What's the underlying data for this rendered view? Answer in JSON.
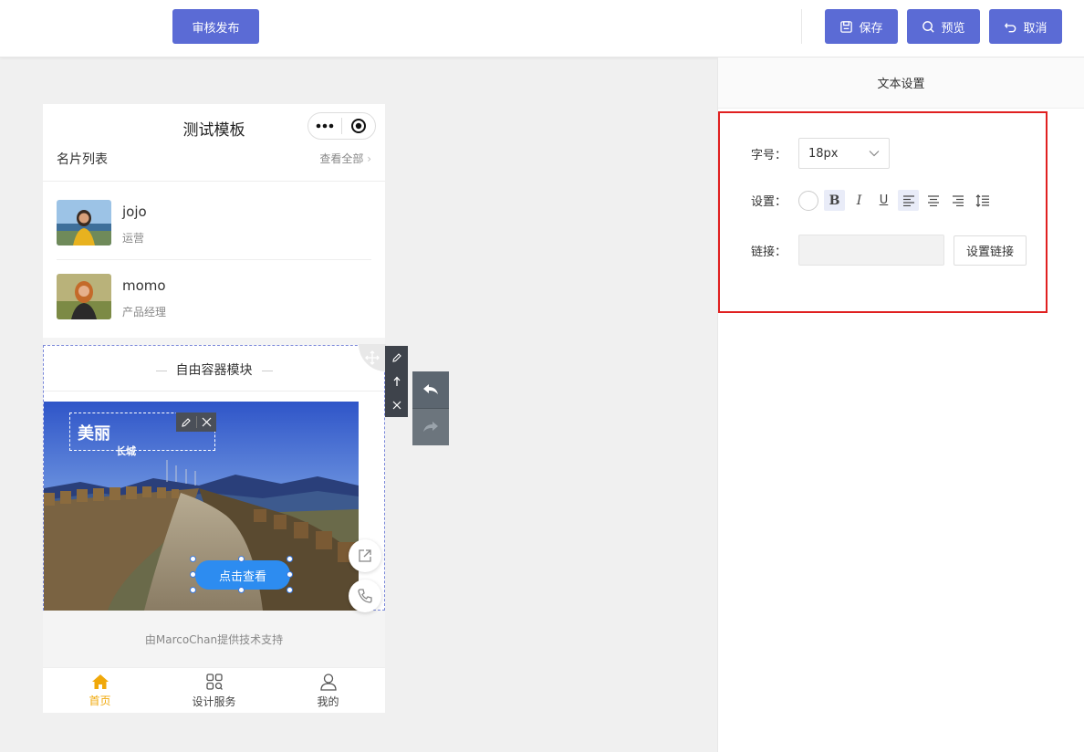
{
  "toolbar": {
    "publish_label": "审核发布",
    "save_label": "保存",
    "preview_label": "预览",
    "cancel_label": "取消"
  },
  "colors": {
    "primary": "#5b6bd5",
    "highlight_border": "#e02020",
    "cta": "#2d8cf0",
    "tab_active": "#f0a80a"
  },
  "panel": {
    "title": "文本设置",
    "font_size_label": "字号：",
    "font_size_value": "18px",
    "format_label": "设置：",
    "format_tools": [
      "color-picker",
      "bold",
      "italic",
      "underline",
      "align-left",
      "align-center",
      "align-right",
      "line-height"
    ],
    "link_label": "链接：",
    "link_value": "",
    "link_button": "设置链接"
  },
  "phone": {
    "title": "测试模板",
    "section_title": "名片列表",
    "see_all": "查看全部",
    "cards": [
      {
        "name": "jojo",
        "role": "运营"
      },
      {
        "name": "momo",
        "role": "产品经理"
      }
    ],
    "module_title": "自由容器模块",
    "image_text_big": "美丽",
    "image_text_small": "长城",
    "cta_label": "点击查看",
    "footer_note": "由MarcoChan提供技术支持",
    "tabs": [
      {
        "label": "首页",
        "icon": "home-icon",
        "active": true
      },
      {
        "label": "设计服务",
        "icon": "grid-icon",
        "active": false
      },
      {
        "label": "我的",
        "icon": "user-icon",
        "active": false
      }
    ]
  }
}
